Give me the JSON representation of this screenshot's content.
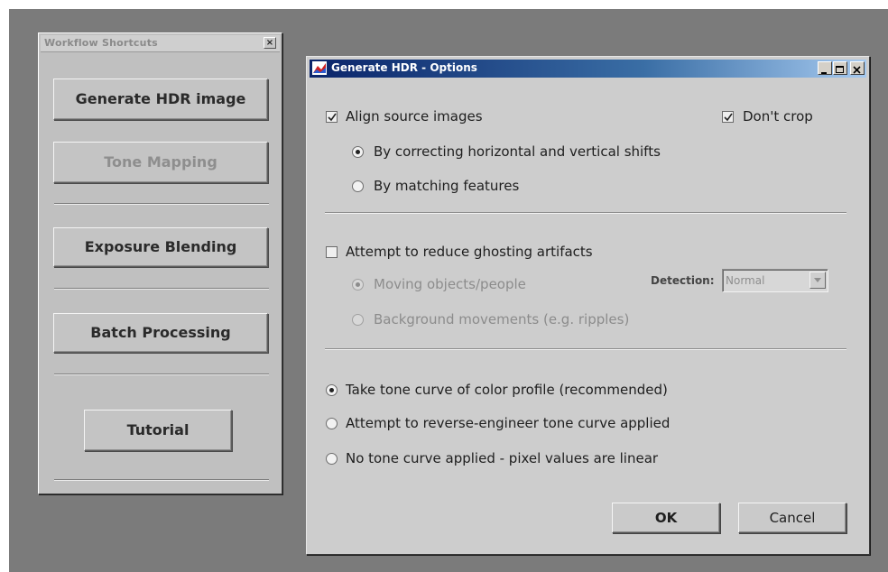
{
  "palette": {
    "title": "Workflow Shortcuts",
    "close_glyph": "×",
    "buttons": {
      "generate_hdr": "Generate HDR image",
      "tone_mapping": "Tone Mapping",
      "exposure_blending": "Exposure Blending",
      "batch_processing": "Batch Processing",
      "tutorial": "Tutorial"
    }
  },
  "dialog": {
    "title": "Generate HDR - Options",
    "window_buttons": {
      "minimize": "_",
      "maximize": "□",
      "close": "×"
    },
    "align": {
      "label": "Align source images",
      "checked": true,
      "options": [
        {
          "label": "By correcting horizontal and vertical shifts",
          "selected": true
        },
        {
          "label": "By matching features",
          "selected": false
        }
      ]
    },
    "dont_crop": {
      "label": "Don't crop",
      "checked": true
    },
    "ghosting": {
      "label": "Attempt to reduce ghosting artifacts",
      "checked": false,
      "options": [
        {
          "label": "Moving objects/people",
          "selected": true
        },
        {
          "label": "Background movements (e.g. ripples)",
          "selected": false
        }
      ],
      "detection_label": "Detection:",
      "detection_value": "Normal"
    },
    "tone_curve": {
      "options": [
        {
          "label": "Take tone curve of color profile (recommended)",
          "selected": true
        },
        {
          "label": "Attempt to reverse-engineer tone curve applied",
          "selected": false
        },
        {
          "label": "No tone curve applied - pixel values are linear",
          "selected": false
        }
      ]
    },
    "ok_label": "OK",
    "cancel_label": "Cancel"
  },
  "icons": {
    "app_icon": "hdr-app-icon",
    "checkbox_checked": "check-icon",
    "dropdown_arrow": "chevron-down-icon"
  },
  "colors": {
    "titlebar_start": "#0a246a",
    "titlebar_end": "#a6caf0",
    "panel": "#cdcdcd",
    "desktop": "#7b7b7b"
  }
}
